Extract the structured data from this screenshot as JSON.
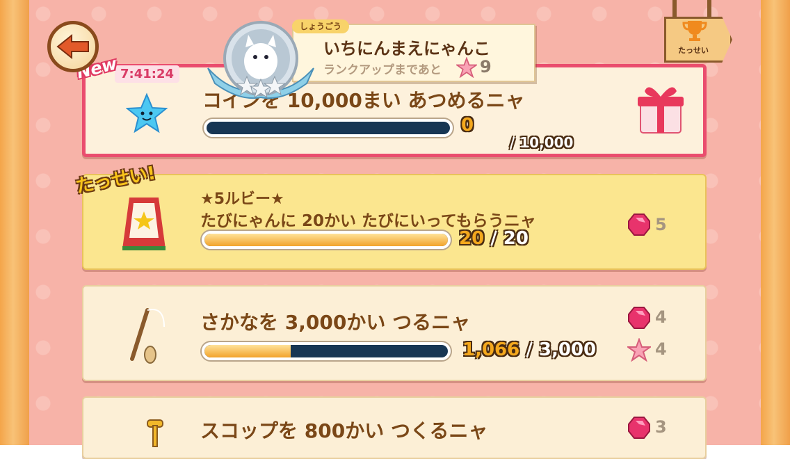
{
  "header": {
    "back_label": "back",
    "title_tab": "しょうごう",
    "rank_name": "いちにんまえにゃんこ",
    "rank_up_text": "ランクアップまであと",
    "rank_up_remaining": "9",
    "achievements_sign": "たっせい"
  },
  "missions": [
    {
      "badge": "New",
      "timer": "7:41:24",
      "title": "コインを 10,000まい あつめるニャ",
      "progress": 0,
      "current": "0",
      "target": "/ 10,000",
      "reward_icon": "gift-box-icon"
    },
    {
      "badge": "たっせい!",
      "subtitle": "★5ルビー★",
      "title": "たびにゃんに 20かい たびにいってもらうニャ",
      "progress": 1.0,
      "current": "20",
      "target": "/ 20",
      "reward_ruby": "5"
    },
    {
      "title": "さかなを 3,000かい つるニャ",
      "progress": 0.355,
      "current": "1,066",
      "target": "/ 3,000",
      "reward_ruby": "4",
      "reward_star": "4"
    },
    {
      "title": "スコップを 800かい つくるニャ",
      "reward_ruby": "3"
    }
  ],
  "colors": {
    "new_border": "#ea4d6e",
    "done_bg": "#fbe68f",
    "bar_track": "#173654",
    "bar_fill": "#f2a32a"
  }
}
